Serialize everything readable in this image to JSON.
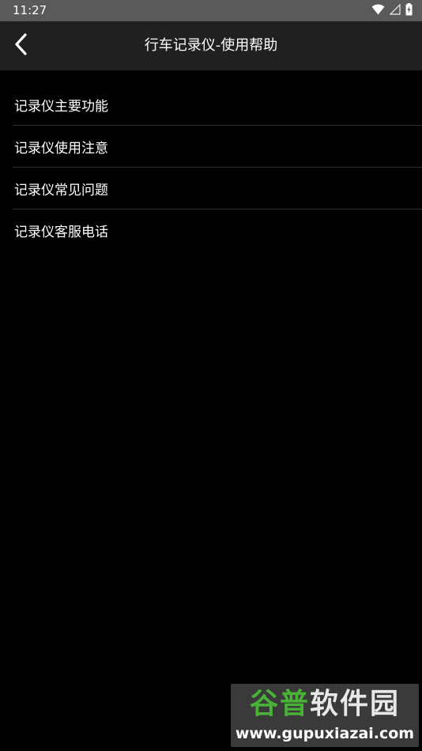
{
  "status_bar": {
    "time": "11:27",
    "icons": [
      "wifi-icon",
      "signal-icon",
      "battery-charging-icon"
    ]
  },
  "app_bar": {
    "title": "行车记录仪-使用帮助",
    "back_icon": "chevron-left-icon"
  },
  "menu": {
    "items": [
      {
        "label": "记录仪主要功能"
      },
      {
        "label": "记录仪使用注意"
      },
      {
        "label": "记录仪常见问题"
      },
      {
        "label": "记录仪客服电话"
      }
    ]
  },
  "watermark": {
    "brand_part1": "谷普",
    "brand_part2": "软件园",
    "url": "www.gupuxiazai.com"
  },
  "colors": {
    "background": "#000000",
    "status_bar": "#5a5a5a",
    "app_bar": "#202020",
    "divider": "#2c2c2c",
    "text": "#ffffff",
    "watermark_green": "#49b337"
  }
}
